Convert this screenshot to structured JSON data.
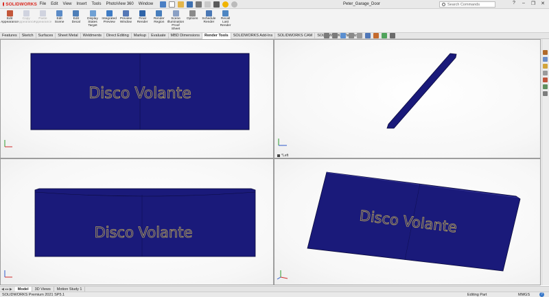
{
  "app": {
    "logo": "SOLIDWORKS",
    "document_title": "Peter_Garage_Door"
  },
  "menus": [
    "File",
    "Edit",
    "View",
    "Insert",
    "Tools",
    "PhotoView 360",
    "Window"
  ],
  "search": {
    "placeholder": "Search Commands"
  },
  "window_buttons": {
    "minimize": "–",
    "restore": "❐",
    "close": "✕",
    "help": "?"
  },
  "ribbon": {
    "buttons": [
      {
        "label": "Edit\nAppearance",
        "icon": "edit-appearance-icon",
        "disabled": false
      },
      {
        "label": "Copy\nAppearance",
        "icon": "copy-appearance-icon",
        "disabled": true
      },
      {
        "label": "Paste\nAppearance",
        "icon": "paste-appearance-icon",
        "disabled": true
      },
      {
        "label": "Edit\nScene",
        "icon": "edit-scene-icon",
        "disabled": false
      },
      {
        "label": "Edit\nDecal",
        "icon": "edit-decal-icon",
        "disabled": false
      },
      {
        "label": "Display\nStates\nTarget",
        "icon": "display-states-icon",
        "disabled": false
      },
      {
        "label": "Integrated\nPreview",
        "icon": "integrated-preview-icon",
        "disabled": false
      },
      {
        "label": "Preview\nWindow",
        "icon": "preview-window-icon",
        "disabled": false
      },
      {
        "label": "Final\nRender",
        "icon": "final-render-icon",
        "disabled": false
      },
      {
        "label": "Render\nRegion",
        "icon": "render-region-icon",
        "disabled": false
      },
      {
        "label": "Scene\nIllumination\nProof Sheet",
        "icon": "scene-illumination-icon",
        "disabled": false
      },
      {
        "label": "Options",
        "icon": "options-icon",
        "disabled": false
      },
      {
        "label": "Schedule\nRender",
        "icon": "schedule-render-icon",
        "disabled": false
      },
      {
        "label": "Recall\nLast\nRender",
        "icon": "recall-last-render-icon",
        "disabled": false
      }
    ]
  },
  "tabs": [
    "Features",
    "Sketch",
    "Surfaces",
    "Sheet Metal",
    "Weldments",
    "Direct Editing",
    "Markup",
    "Evaluate",
    "MBD Dimensions",
    "Render Tools",
    "SOLIDWORKS Add-Ins",
    "SOLIDWORKS CAM",
    "SOLIDWORKS Visualize"
  ],
  "active_tab": "Render Tools",
  "model": {
    "decal_text": "Disco Volante",
    "color": "#1a1a7a",
    "text_color": "#b8a45a"
  },
  "viewports": {
    "left_view_label": "*Left"
  },
  "bottom_tabs": [
    "Model",
    "3D Views",
    "Motion Study 1"
  ],
  "active_bottom_tab": "Model",
  "status": {
    "product": "SOLIDWORKS Premium 2021 SP5.1",
    "mode": "Editing Part",
    "units": "MMGS"
  }
}
